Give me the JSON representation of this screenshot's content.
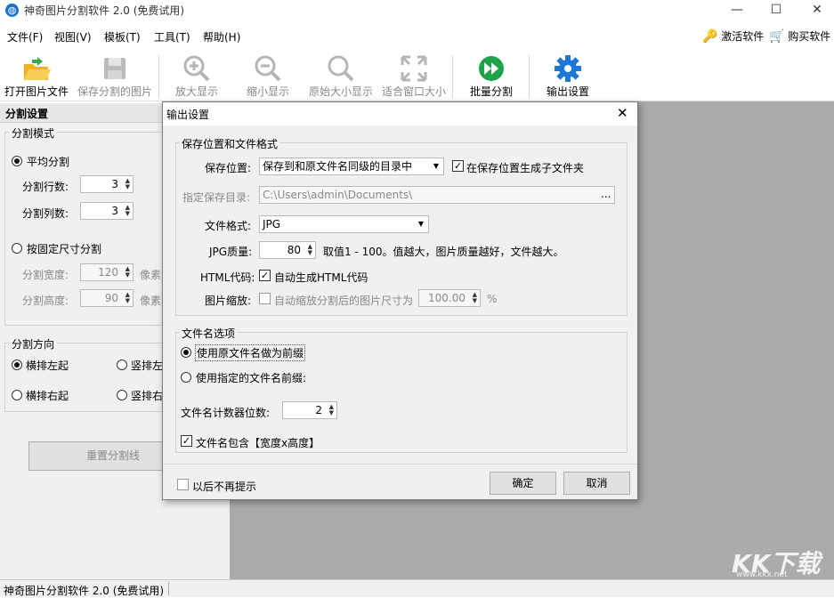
{
  "app": {
    "title": "神奇图片分割软件 2.0 (免费试用)",
    "icon": "globe-icon"
  },
  "window": {
    "minimize": "—",
    "maximize": "☐",
    "close": "✕"
  },
  "menu": [
    "文件(F)",
    "视图(V)",
    "模板(T)",
    "工具(T)",
    "帮助(H)"
  ],
  "menu_right": {
    "activate": "激活软件",
    "buy": "购买软件"
  },
  "toolbar": [
    {
      "label": "打开图片文件",
      "icon": "open-folder-icon",
      "enabled": true
    },
    {
      "label": "保存分割的图片",
      "icon": "save-disk-icon",
      "enabled": false
    },
    {
      "label": "放大显示",
      "icon": "zoom-in-icon",
      "enabled": false
    },
    {
      "label": "缩小显示",
      "icon": "zoom-out-icon",
      "enabled": false
    },
    {
      "label": "原始大小显示",
      "icon": "magnifier-icon",
      "enabled": false
    },
    {
      "label": "适合窗口大小",
      "icon": "fit-window-icon",
      "enabled": false
    },
    {
      "label": "批量分割",
      "icon": "play-icon",
      "enabled": true
    },
    {
      "label": "输出设置",
      "icon": "gear-icon",
      "enabled": true
    }
  ],
  "left": {
    "header": "分割设置",
    "mode_group": "分割模式",
    "avg_split": "平均分割",
    "rows_label": "分割行数:",
    "rows_value": "3",
    "cols_label": "分割列数:",
    "cols_value": "3",
    "fixed_split": "按固定尺寸分割",
    "width_label": "分割宽度:",
    "width_value": "120",
    "width_unit": "像素",
    "height_label": "分割高度:",
    "height_value": "90",
    "height_unit": "像素",
    "dir_group": "分割方向",
    "dir1": "横排左起",
    "dir2": "竖排左",
    "dir3": "横排右起",
    "dir4": "竖排右",
    "reset_btn": "重置分割线"
  },
  "dialog": {
    "title": "输出设置",
    "g1_title": "保存位置和文件格式",
    "save_loc_label": "保存位置:",
    "save_loc_value": "保存到和原文件名同级的目录中",
    "subfolder_label": "在保存位置生成子文件夹",
    "dir_label": "指定保存目录:",
    "dir_value": "C:\\Users\\admin\\Documents\\",
    "browse": "...",
    "format_label": "文件格式:",
    "format_value": "JPG",
    "quality_label": "JPG质量:",
    "quality_value": "80",
    "quality_hint": "取值1 - 100。值越大，图片质量越好，文件越大。",
    "html_label": "HTML代码:",
    "html_check": "自动生成HTML代码",
    "scale_label": "图片缩放:",
    "scale_check": "自动缩放分割后的图片尺寸为",
    "scale_value": "100.00",
    "scale_unit": "%",
    "g2_title": "文件名选项",
    "opt1": "使用原文件名做为前缀",
    "opt2": "使用指定的文件名前缀:",
    "counter_label": "文件名计数器位数:",
    "counter_value": "2",
    "include_size": "文件名包含【宽度x高度】",
    "dont_show": "以后不再提示",
    "ok": "确定",
    "cancel": "取消"
  },
  "status": {
    "text": "神奇图片分割软件 2.0 (免费试用)"
  },
  "watermark": {
    "logo": "KK下载",
    "url": "www.kkx.net"
  }
}
